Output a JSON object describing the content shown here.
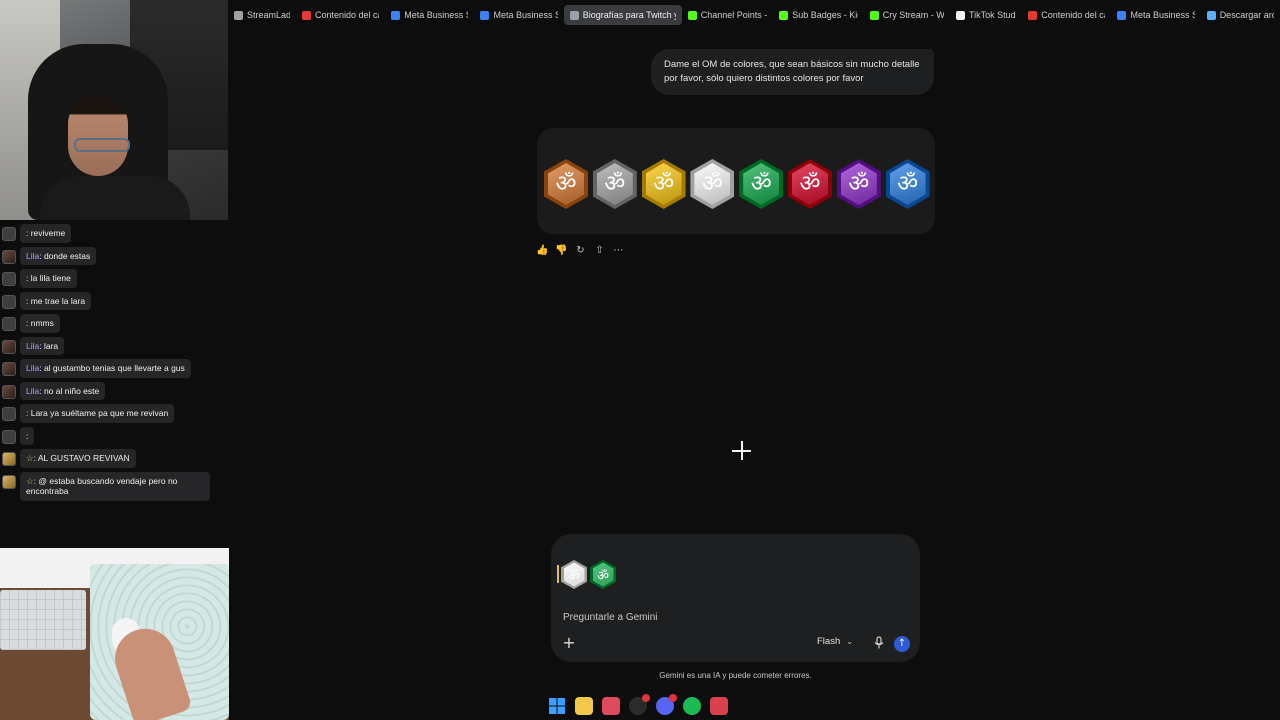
{
  "bookmarks": [
    {
      "label": "StreamLadd",
      "icon": "streamladder-icon",
      "color": "#9aa0a6"
    },
    {
      "label": "Contenido del can",
      "icon": "youtube-icon",
      "color": "#e53935"
    },
    {
      "label": "Meta Business Su",
      "icon": "meta-icon",
      "color": "#3b82f6"
    },
    {
      "label": "Meta Business Su",
      "icon": "meta-icon",
      "color": "#3b82f6"
    },
    {
      "label": "Biografías para Twitch y K",
      "icon": "bio-icon",
      "color": "#9aa0a6",
      "active": true
    },
    {
      "label": "Channel Points - K",
      "icon": "kick-icon",
      "color": "#53fc18"
    },
    {
      "label": "Sub Badges - Kick",
      "icon": "kick-icon",
      "color": "#53fc18"
    },
    {
      "label": "Cry Stream - Wat",
      "icon": "kick-icon",
      "color": "#53fc18"
    },
    {
      "label": "TikTok Studio",
      "icon": "tiktok-icon",
      "color": "#f0f0f0"
    },
    {
      "label": "Contenido del can",
      "icon": "youtube-icon",
      "color": "#e53935"
    },
    {
      "label": "Meta Business Su",
      "icon": "meta-icon",
      "color": "#3b82f6"
    },
    {
      "label": "Descargar arch",
      "icon": "diamond-icon",
      "color": "#5ab0ff"
    }
  ],
  "chat": [
    {
      "user": "",
      "text": ": reviveme",
      "avatar": "default"
    },
    {
      "user": "Lila",
      "text": ": donde estas",
      "avatar": "img"
    },
    {
      "user": "",
      "text": ": la lila tiene",
      "avatar": "default"
    },
    {
      "user": "",
      "text": ": me trae la lara",
      "avatar": "default"
    },
    {
      "user": "",
      "text": ": nmms",
      "avatar": "default"
    },
    {
      "user": "Lila",
      "text": ": lara",
      "avatar": "img"
    },
    {
      "user": "Lila",
      "text": ": al gustambo tenias que llevarte a gus",
      "avatar": "img"
    },
    {
      "user": "Lila",
      "text": ": no al niño este",
      "avatar": "img"
    },
    {
      "user": "",
      "text": ": Lara ya suéltame pa que me revivan",
      "avatar": "default"
    },
    {
      "user": "",
      "text": ":",
      "avatar": "default"
    },
    {
      "user": "☆",
      "text": ": AL GUSTAVO REVIVAN",
      "avatar": "y"
    },
    {
      "user": "☆",
      "text": ": @ estaba buscando vendaje pero no encontraba",
      "avatar": "y"
    }
  ],
  "conversation": {
    "user_prompt": "Dame el OM de colores, que sean básicos sin mucho detalle por favor, sólo quiero distintos colores por favor",
    "om_symbols": [
      {
        "glyph": "ॐ",
        "color": "#c07a45",
        "name": "orange"
      },
      {
        "glyph": "ॐ",
        "color": "#9b9b9b",
        "name": "gray"
      },
      {
        "glyph": "ॐ",
        "color": "#d9b22a",
        "name": "yellow"
      },
      {
        "glyph": "ॐ",
        "color": "#d8d8d8",
        "name": "white"
      },
      {
        "glyph": "ॐ",
        "color": "#2ea05a",
        "name": "green"
      },
      {
        "glyph": "ॐ",
        "color": "#c2253f",
        "name": "red"
      },
      {
        "glyph": "ॐ",
        "color": "#8c45b8",
        "name": "purple"
      },
      {
        "glyph": "ॐ",
        "color": "#3f7fc9",
        "name": "blue"
      }
    ]
  },
  "composer": {
    "attachments": [
      {
        "glyph": "ॐ",
        "color": "#d8d8d8"
      },
      {
        "glyph": "ॐ",
        "color": "#2ea05a"
      }
    ],
    "placeholder": "Preguntarle a Gemini",
    "model": "Flash"
  },
  "disclaimer": "Gemini es una IA y puede cometer errores.",
  "taskbar": [
    {
      "name": "windows-start-icon",
      "color": "#3aa0ff"
    },
    {
      "name": "file-explorer-icon",
      "color": "#f2c94c"
    },
    {
      "name": "app-red-icon",
      "color": "#e04a5f"
    },
    {
      "name": "obs-icon",
      "color": "#2b2b2b",
      "badge": true
    },
    {
      "name": "discord-icon",
      "color": "#5865f2",
      "badge": true
    },
    {
      "name": "spotify-icon",
      "color": "#1db954"
    },
    {
      "name": "opera-icon",
      "color": "#d9414d"
    }
  ]
}
